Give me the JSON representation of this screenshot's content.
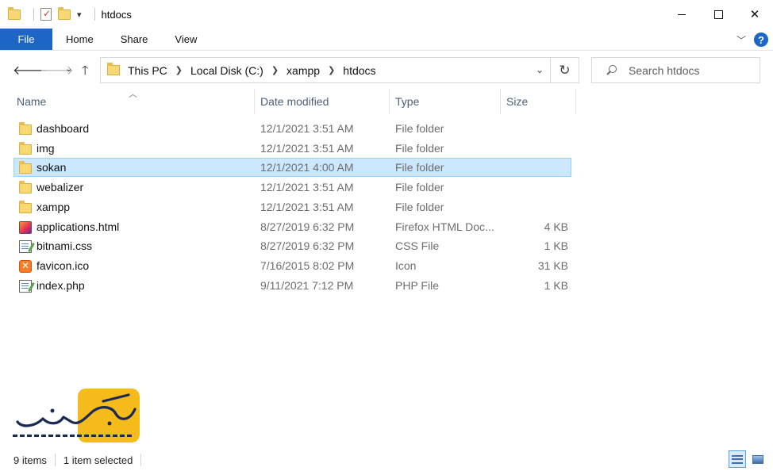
{
  "window": {
    "title": "htdocs",
    "controls": {
      "minimize": "minimize",
      "maximize": "maximize",
      "close": "✕"
    }
  },
  "ribbon": {
    "tabs": [
      "File",
      "Home",
      "Share",
      "View"
    ],
    "help": "?"
  },
  "address": {
    "crumbs": [
      "This PC",
      "Local Disk (C:)",
      "xampp",
      "htdocs"
    ]
  },
  "search": {
    "placeholder": "Search htdocs"
  },
  "columns": {
    "name": "Name",
    "date": "Date modified",
    "type": "Type",
    "size": "Size"
  },
  "files": [
    {
      "name": "dashboard",
      "date": "12/1/2021 3:51 AM",
      "type": "File folder",
      "size": "",
      "icon": "folder-icon",
      "selected": false
    },
    {
      "name": "img",
      "date": "12/1/2021 3:51 AM",
      "type": "File folder",
      "size": "",
      "icon": "folder-icon",
      "selected": false
    },
    {
      "name": "sokan",
      "date": "12/1/2021 4:00 AM",
      "type": "File folder",
      "size": "",
      "icon": "folder-icon",
      "selected": true
    },
    {
      "name": "webalizer",
      "date": "12/1/2021 3:51 AM",
      "type": "File folder",
      "size": "",
      "icon": "folder-icon",
      "selected": false
    },
    {
      "name": "xampp",
      "date": "12/1/2021 3:51 AM",
      "type": "File folder",
      "size": "",
      "icon": "folder-icon",
      "selected": false
    },
    {
      "name": "applications.html",
      "date": "8/27/2019 6:32 PM",
      "type": "Firefox HTML Doc...",
      "size": "4 KB",
      "icon": "firefox-html-icon",
      "selected": false
    },
    {
      "name": "bitnami.css",
      "date": "8/27/2019 6:32 PM",
      "type": "CSS File",
      "size": "1 KB",
      "icon": "css-file-icon",
      "selected": false
    },
    {
      "name": "favicon.ico",
      "date": "7/16/2015 8:02 PM",
      "type": "Icon",
      "size": "31 KB",
      "icon": "xampp-ico-icon",
      "selected": false
    },
    {
      "name": "index.php",
      "date": "9/11/2021 7:12 PM",
      "type": "PHP File",
      "size": "1 KB",
      "icon": "php-file-icon",
      "selected": false
    }
  ],
  "status": {
    "item_count": "9 items",
    "selection": "1 item selected"
  },
  "colors": {
    "accent": "#1e66c6",
    "selection_bg": "#cce8ff",
    "selection_border": "#99d1ff",
    "logo_yellow": "#f5bb1a",
    "logo_navy": "#1b2a55"
  }
}
